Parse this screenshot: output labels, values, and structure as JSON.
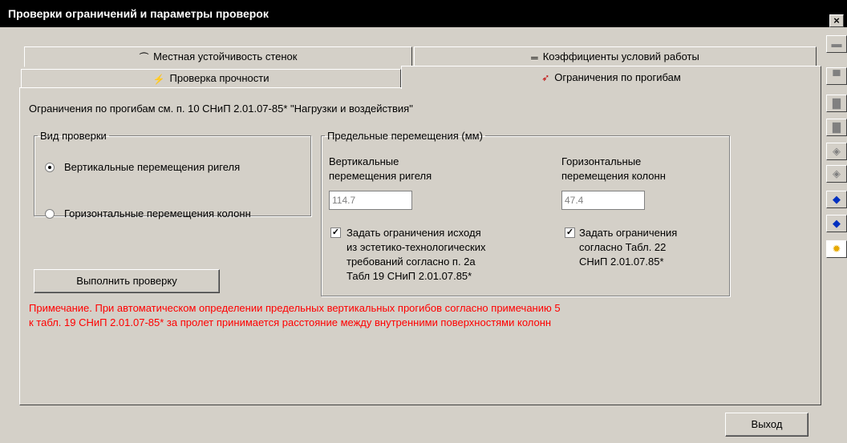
{
  "window": {
    "title": "Проверки ограничений и параметры проверок",
    "close_label": "×"
  },
  "tabs": {
    "local_stability": "Местная устойчивость стенок",
    "work_coefficients": "Коэффициенты условий работы",
    "strength_check": "Проверка прочности",
    "deflection_limits": "Ограничения по прогибам"
  },
  "content": {
    "info": "Ограничения по прогибам см. п. 10 СНиП 2.01.07-85* \"Нагрузки и воздействия\"",
    "check_type": {
      "legend": "Вид проверки",
      "options": [
        "Вертикальные перемещения ригеля",
        "Горизонтальные перемещения колонн"
      ],
      "selected": 0
    },
    "limits": {
      "legend": "Предельные перемещения (мм)",
      "vertical": {
        "label_line1": "Вертикальные",
        "label_line2": "перемещения ригеля",
        "value": "114.7",
        "checkbox_lines": [
          "Задать ограничения исходя",
          "из эстетико-технологических",
          "требований согласно п. 2а",
          "Табл 19 СНиП 2.01.07.85*"
        ],
        "checked": true
      },
      "horizontal": {
        "label_line1": "Горизонтальные",
        "label_line2": "перемещения колонн",
        "value": "47.4",
        "checkbox_lines": [
          "Задать ограничения",
          "согласно Табл. 22",
          "СНиП 2.01.07.85*"
        ],
        "checked": true
      }
    },
    "run_button": "Выполнить проверку",
    "note_line1": "Примечание. При автоматическом определении предельных вертикальных прогибов согласно примечанию 5",
    "note_line2": "к табл. 19 СНиП 2.01.07-85* за пролет принимается расстояние между внутренними поверхностями колонн"
  },
  "exit_button": "Выход",
  "colors": {
    "note": "#ff0000",
    "titlebar": "#000000",
    "background": "#d4d0c8"
  },
  "icons": [
    "arch-icon",
    "double-line-icon",
    "strength-icon",
    "deflection-icon"
  ],
  "side_toolbar": [
    "beam-icon",
    "beam-profile-icon",
    "frame-icon",
    "frame-alt-icon",
    "node-icon",
    "node-alt-icon",
    "blue-node-icon",
    "blue-node-alt-icon",
    "gear-icon"
  ]
}
